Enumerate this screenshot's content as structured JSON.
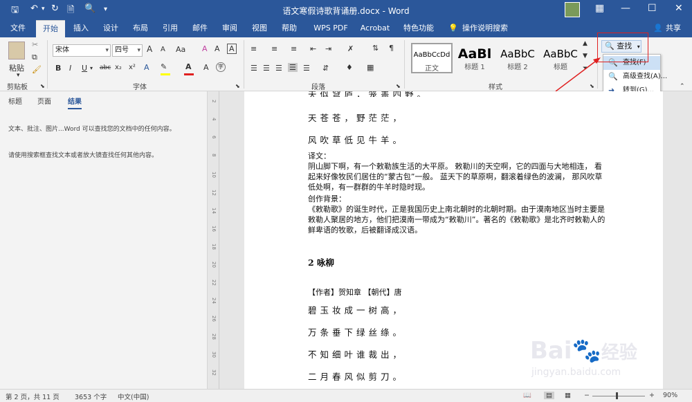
{
  "window": {
    "title": "语文寒假诗歌背诵册.docx - Word",
    "user_initials": "",
    "icons": [
      "save-icon",
      "undo-icon",
      "new-doc-icon",
      "print-preview-icon",
      "customize-qat-icon",
      "ribbon-display-icon",
      "minimize-icon",
      "restore-icon",
      "close-icon"
    ]
  },
  "tabs": [
    {
      "label": "文件"
    },
    {
      "label": "开始"
    },
    {
      "label": "插入"
    },
    {
      "label": "设计"
    },
    {
      "label": "布局"
    },
    {
      "label": "引用"
    },
    {
      "label": "邮件"
    },
    {
      "label": "审阅"
    },
    {
      "label": "视图"
    },
    {
      "label": "帮助"
    },
    {
      "label": "WPS PDF"
    },
    {
      "label": "Acrobat"
    },
    {
      "label": "特色功能"
    },
    {
      "label": "操作说明搜索"
    }
  ],
  "share": "共享",
  "ribbon": {
    "clipboard": {
      "paste": "粘贴",
      "label": "剪贴板"
    },
    "font": {
      "name": "宋体",
      "size": "四号",
      "label": "字体",
      "bold": "B",
      "italic": "I",
      "underline": "U",
      "strike": "abc",
      "sub": "x₂",
      "sup": "x²",
      "grow": "A",
      "shrink": "A",
      "case": "Aa",
      "clear": "A",
      "char_border": "A",
      "highlight_label": "A",
      "color_label": "A",
      "phonetic": "A",
      "enclose": "字"
    },
    "paragraph": {
      "label": "段落"
    },
    "styles": {
      "label": "样式",
      "items": [
        {
          "preview": "AaBbCcDd",
          "name": "正文"
        },
        {
          "preview": "AaBl",
          "name": "标题 1"
        },
        {
          "preview": "AaBbC",
          "name": "标题 2"
        },
        {
          "preview": "AaBbC",
          "name": "标题"
        }
      ]
    },
    "editing": {
      "find": "查找"
    }
  },
  "find_menu": {
    "items": [
      "查找(F)",
      "高级查找(A)...",
      "转到(G)..."
    ]
  },
  "nav": {
    "tabs": [
      "标题",
      "页面",
      "结果"
    ],
    "text1": "文本、批注、图片...Word 可以查找您的文档中的任何内容。",
    "text2": "请使用搜索框查找文本或者放大镜查找任何其他内容。"
  },
  "ruler_marks": [
    "2",
    "4",
    "6",
    "8",
    "10",
    "12",
    "14",
    "16",
    "18",
    "20",
    "22",
    "24",
    "26",
    "28",
    "30",
    "32"
  ],
  "doc": {
    "line_top": "天似穹庐，笼盖四野。",
    "line1": "天苍苍，野茫茫，",
    "line2": "风吹草低见牛羊。",
    "trans_title": "译文：",
    "trans_body": "阴山脚下啊，有一个敕勒族生活的大平原。 敕勒川的天空啊，它的四面与大地相连， 看起来好像牧民们居住的“蒙古包”一般。 蓝天下的草原啊，翻滚着绿色的波澜， 那风吹草低处啊，有一群群的牛羊时隐时现。",
    "bg_title": "创作背景：",
    "bg_body": "《敕勒歌》的诞生时代，正是我国历史上南北朝时的北朝时期。由于漠南地区当时主要是敕勒人聚居的地方，他们把漠南一带成为“敕勒川”。著名的《敕勒歌》是北齐时敕勒人的鲜卑语的牧歌，后被翻译成汉语。",
    "heading": "2 咏柳",
    "author": "【作者】贺知章 【朝代】唐",
    "p1": "碧玉妆成一树高，",
    "p2": "万条垂下绿丝绦。",
    "p3": "不知细叶谁裁出，",
    "p4": "二月春风似剪刀。"
  },
  "status": {
    "page": "第 2 页，共 11 页",
    "words": "3653 个字",
    "lang": "中文(中国)",
    "zoom": "90%"
  },
  "watermark": {
    "brand": "Bai",
    "brand2": "经验",
    "url": "jingyan.baidu.com"
  },
  "colors": {
    "accent": "#2b579a",
    "red": "#e02020"
  }
}
